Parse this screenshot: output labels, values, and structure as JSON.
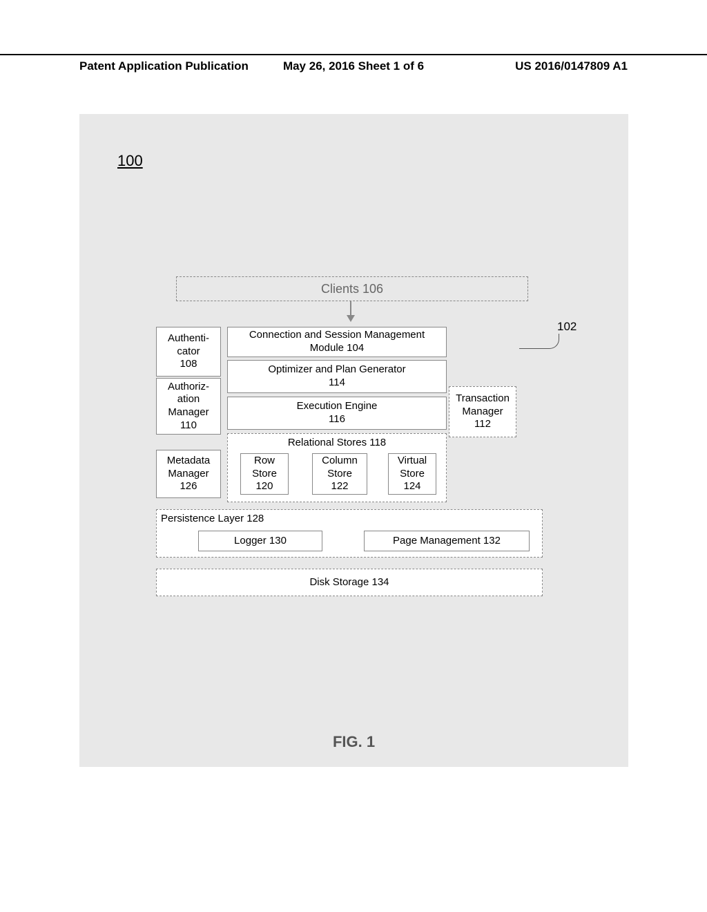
{
  "header": {
    "left": "Patent Application Publication",
    "center": "May 26, 2016 Sheet 1 of 6",
    "right": "US 2016/0147809 A1"
  },
  "refs": {
    "system_ref_100": "100",
    "system_ref_102": "102"
  },
  "clients": "Clients 106",
  "left_stack": {
    "authenticator": "Authenti-\ncator\n108",
    "authorization": "Authoriz-\nation\nManager\n110",
    "metadata": "Metadata\nManager\n126"
  },
  "middle": {
    "conn_session": "Connection and Session Management\nModule 104",
    "optimizer": "Optimizer and Plan Generator\n114",
    "exec_engine": "Execution Engine\n116",
    "rel_stores_title": "Relational Stores 118",
    "row_store": "Row\nStore\n120",
    "col_store": "Column\nStore\n122",
    "virt_store": "Virtual\nStore\n124"
  },
  "right": {
    "transaction": "Transaction\nManager\n112"
  },
  "persistence": {
    "title": "Persistence Layer 128",
    "logger": "Logger 130",
    "page_mgmt": "Page Management 132"
  },
  "disk": "Disk Storage 134",
  "caption": "FIG. 1"
}
